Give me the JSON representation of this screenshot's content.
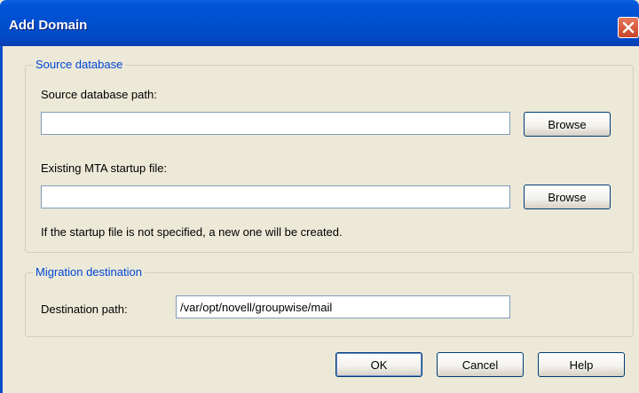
{
  "dialog": {
    "title": "Add Domain"
  },
  "source_group": {
    "legend": "Source database",
    "db_path_label": "Source database path:",
    "db_path_value": "",
    "mta_label": "Existing MTA startup file:",
    "mta_value": "",
    "browse_label": "Browse",
    "note": "If the startup file is not specified, a new one will be created."
  },
  "destination_group": {
    "legend": "Migration destination",
    "path_label": "Destination path:",
    "path_value": "/var/opt/novell/groupwise/mail"
  },
  "buttons": {
    "ok": "OK",
    "cancel": "Cancel",
    "help": "Help"
  },
  "icons": {
    "close": "close-icon"
  },
  "colors": {
    "title_bar": "#0050d0",
    "group_legend": "#0046d5",
    "dialog_bg": "#ece9d8",
    "close_button": "#c8442a"
  }
}
